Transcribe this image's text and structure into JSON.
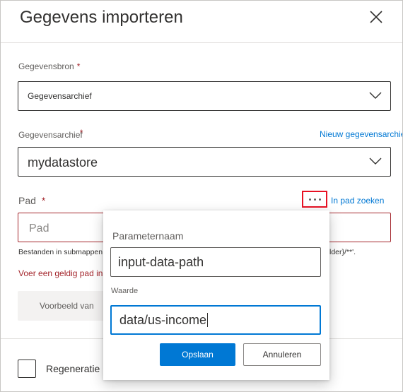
{
  "dialog": {
    "title": "Gegevens importeren",
    "close_icon": "close-icon"
  },
  "data_source": {
    "label": "Gegevensbron",
    "required_mark": "*",
    "value": "Gegevensarchief"
  },
  "datastore": {
    "label": "Gegevensarchief",
    "required_mark": "*",
    "new_link": "Nieuw gegevensarchief",
    "value": "mydatastore"
  },
  "path": {
    "label": "Pad",
    "required_mark": "*",
    "browse_icon": "more-ellipsis-icon",
    "search_link": "In pad zoeken",
    "placeholder": "Pad",
    "hint_left": "Bestanden in submappen opnemen",
    "hint_right": "lder}/**'.",
    "error": "Voer een geldig pad in",
    "preview_button": "Voorbeeld van"
  },
  "regenerate": {
    "label": "Regeneratie"
  },
  "param_popup": {
    "name_label": "Parameternaam",
    "name_value": "input-data-path",
    "value_label": "Waarde",
    "value_value": "data/us-income",
    "save_button": "Opslaan",
    "cancel_button": "Annuleren"
  },
  "colors": {
    "primary": "#0078d4",
    "error": "#a4262c",
    "highlight": "#e81123"
  }
}
